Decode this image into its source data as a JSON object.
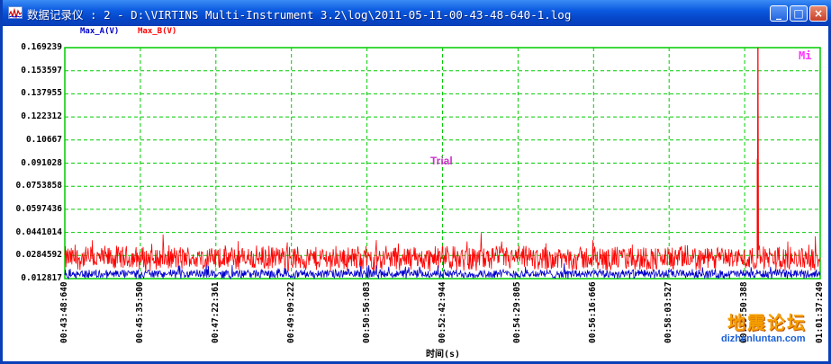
{
  "window": {
    "title": "数据记录仪 : 2 - D:\\VIRTINS Multi-Instrument 3.2\\log\\2011-05-11-00-43-48-640-1.log",
    "minimize_label": "_",
    "maximize_label": "□",
    "close_label": "×"
  },
  "colors": {
    "series_a": "#0000cc",
    "series_b": "#ff0000",
    "grid": "#00cc00",
    "plot_border": "#00cc00"
  },
  "chart_data": {
    "type": "line",
    "xlabel": "时间(s)",
    "y_ticks": [
      "0.169239",
      "0.153597",
      "0.137955",
      "0.122312",
      "0.10667",
      "0.091028",
      "0.0753858",
      "0.0597436",
      "0.0441014",
      "0.0284592",
      "0.012817"
    ],
    "x_ticks": [
      "00:43:48:640",
      "00:45:35:500",
      "00:47:22:361",
      "00:49:09:222",
      "00:50:56:083",
      "00:52:42:944",
      "00:54:29:805",
      "00:56:16:666",
      "00:58:03:527",
      "00:59:50:388",
      "01:01:37:249"
    ],
    "ylim": [
      0.012817,
      0.169239
    ],
    "grid": true,
    "legend_placement": "top-left",
    "series": [
      {
        "name": "Max_A(V)",
        "baseline": 0.016,
        "noise": 0.0035,
        "spikes": []
      },
      {
        "name": "Max_B(V)",
        "baseline": 0.0265,
        "noise": 0.0095,
        "spikes": [
          {
            "x_fraction": 0.9175,
            "y": 0.169239
          },
          {
            "x_fraction": 0.9168,
            "y": 0.094
          }
        ]
      }
    ]
  },
  "watermark": "Trial",
  "mi_badge": "Mi",
  "site_logo": "地震论坛",
  "site_url": "dizhenluntan.com"
}
